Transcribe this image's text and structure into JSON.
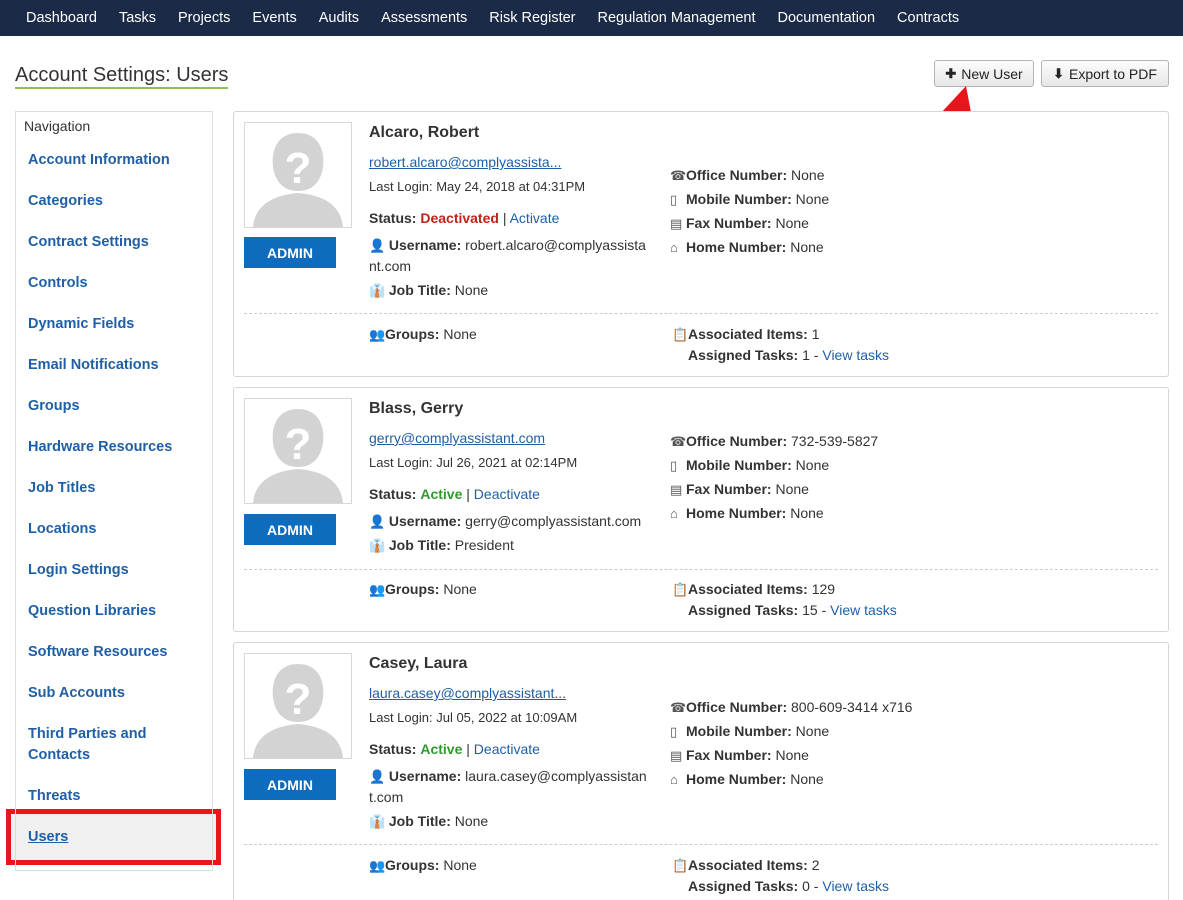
{
  "topnav": [
    "Dashboard",
    "Tasks",
    "Projects",
    "Events",
    "Audits",
    "Assessments",
    "Risk Register",
    "Regulation Management",
    "Documentation",
    "Contracts"
  ],
  "page_title": "Account Settings: Users",
  "buttons": {
    "new_user": "New User",
    "export": "Export to PDF"
  },
  "sidebar": {
    "title": "Navigation",
    "items": [
      "Account Information",
      "Categories",
      "Contract Settings",
      "Controls",
      "Dynamic Fields",
      "Email Notifications",
      "Groups",
      "Hardware Resources",
      "Job Titles",
      "Locations",
      "Login Settings",
      "Question Libraries",
      "Software Resources",
      "Sub Accounts",
      "Third Parties and Contacts",
      "Threats",
      "Users"
    ]
  },
  "labels": {
    "admin": "ADMIN",
    "status": "Status:",
    "username": "Username:",
    "job_title": "Job Title:",
    "office": "Office Number:",
    "mobile": "Mobile Number:",
    "fax": "Fax Number:",
    "home": "Home Number:",
    "groups": "Groups:",
    "associated": "Associated Items:",
    "assigned": "Assigned Tasks:",
    "view_tasks": "View tasks",
    "sep": "|"
  },
  "users": [
    {
      "name": "Alcaro, Robert",
      "email": "robert.alcaro@complyassista...",
      "last_login": "Last Login: May 24, 2018 at 04:31PM",
      "status": "Deactivated",
      "status_action": "Activate",
      "username_1": "robert.alcaro@complyassista",
      "username_2": "nt.com",
      "job_title": "None",
      "office": "None",
      "mobile": "None",
      "fax": "None",
      "home": "None",
      "groups": "None",
      "associated": "1",
      "assigned": "1 -"
    },
    {
      "name": "Blass, Gerry",
      "email": "gerry@complyassistant.com",
      "last_login": "Last Login: Jul 26, 2021 at 02:14PM",
      "status": "Active",
      "status_action": "Deactivate",
      "username_1": "gerry@complyassistant.com",
      "job_title": "President",
      "office": "732-539-5827",
      "mobile": "None",
      "fax": "None",
      "home": "None",
      "groups": "None",
      "associated": "129",
      "assigned": "15 -"
    },
    {
      "name": "Casey, Laura",
      "email": "laura.casey@complyassistant...",
      "last_login": "Last Login: Jul 05, 2022 at 10:09AM",
      "status": "Active",
      "status_action": "Deactivate",
      "username_1": "laura.casey@complyassistan",
      "username_2": "t.com",
      "job_title": "None",
      "office": "800-609-3414 x716",
      "mobile": "None",
      "fax": "None",
      "home": "None",
      "groups": "None",
      "associated": "2",
      "assigned": "0 -"
    }
  ],
  "colors": {
    "topnav": "#1b2a47",
    "link": "#1f5fa6",
    "admin": "#0e6cbf",
    "deactivated": "#c0221b",
    "active": "#2e9a2e",
    "highlight": "#e8151b"
  }
}
